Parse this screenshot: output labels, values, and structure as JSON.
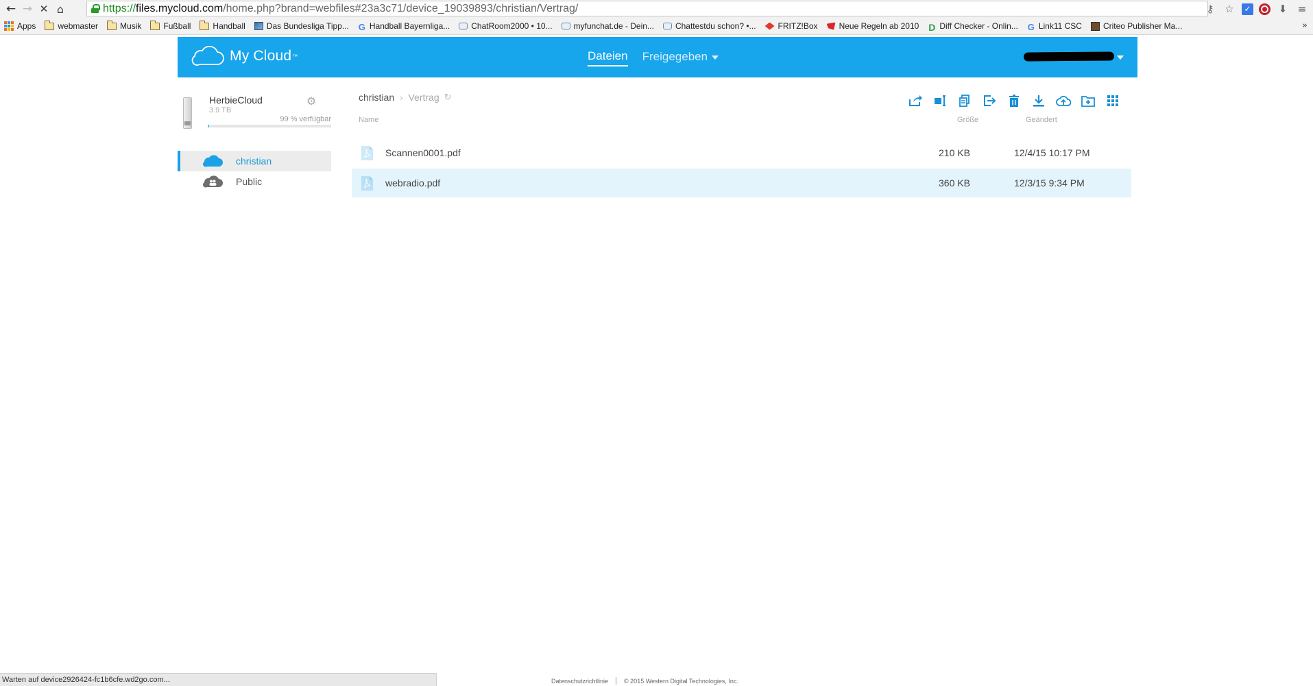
{
  "browser": {
    "url_scheme": "https://",
    "url_host": "files.mycloud.com",
    "url_path": "/home.php?brand=webfiles#23a3c71/device_19039893/christian/Vertrag/",
    "bookmarks": [
      {
        "label": "Apps",
        "icon": "apps-icon"
      },
      {
        "label": "webmaster",
        "icon": "folder-icon"
      },
      {
        "label": "Musik",
        "icon": "folder-icon"
      },
      {
        "label": "Fußball",
        "icon": "folder-icon"
      },
      {
        "label": "Handball",
        "icon": "folder-icon"
      },
      {
        "label": "Das Bundesliga Tipp...",
        "icon": "image-icon"
      },
      {
        "label": "Handball Bayernliga...",
        "icon": "google-icon"
      },
      {
        "label": "ChatRoom2000 • 10...",
        "icon": "chat-icon"
      },
      {
        "label": "myfunchat.de - Dein...",
        "icon": "chat-icon"
      },
      {
        "label": "Chattestdu schon? •...",
        "icon": "chat-icon"
      },
      {
        "label": "FRITZ!Box",
        "icon": "fritz-icon"
      },
      {
        "label": "Neue Regeln ab 2010",
        "icon": "red-icon"
      },
      {
        "label": "Diff Checker - Onlin...",
        "icon": "d-icon"
      },
      {
        "label": "Link11 CSC",
        "icon": "google-icon"
      },
      {
        "label": "Criteo Publisher Ma...",
        "icon": "criteo-icon"
      }
    ],
    "status_text": "Warten auf device2926424-fc1b6cfe.wd2go.com..."
  },
  "header": {
    "logo_text": "My Cloud",
    "logo_tm": "™",
    "nav_files": "Dateien",
    "nav_shared": "Freigegeben",
    "brand_color": "#17a5ec"
  },
  "device": {
    "name": "HerbieCloud",
    "capacity": "3.9 TB",
    "available_label": "99 % verfügbar",
    "used_fraction": 0.01
  },
  "shares": [
    {
      "label": "christian",
      "selected": true,
      "icon": "cloud-icon"
    },
    {
      "label": "Public",
      "selected": false,
      "icon": "public-cloud-icon"
    }
  ],
  "breadcrumb": {
    "root": "christian",
    "current": "Vertrag"
  },
  "columns": {
    "name": "Name",
    "size": "Größe",
    "modified": "Geändert"
  },
  "files": [
    {
      "name": "Scannen0001.pdf",
      "size": "210 KB",
      "modified": "12/4/15 10:17 PM",
      "selected": false
    },
    {
      "name": "webradio.pdf",
      "size": "360 KB",
      "modified": "12/3/15 9:34 PM",
      "selected": true
    }
  ],
  "footer": {
    "privacy": "Datenschutzrichtlinie",
    "copyright": "© 2015 Western Digital Technologies, Inc."
  }
}
